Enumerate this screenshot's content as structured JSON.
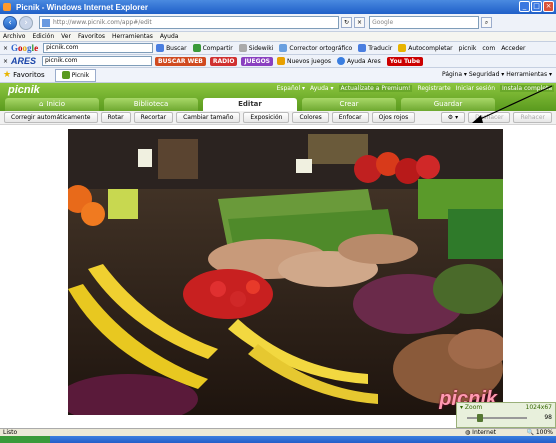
{
  "window": {
    "title": "Picnik - Windows Internet Explorer",
    "address": "http://www.picnik.com/app#/edit",
    "search_placeholder": "Google"
  },
  "menu": [
    "Archivo",
    "Edición",
    "Ver",
    "Favoritos",
    "Herramientas",
    "Ayuda"
  ],
  "google_toolbar": {
    "logo": "Google",
    "query": "picnik.com",
    "items": [
      "Buscar",
      "Compartir",
      "Sidewiki",
      "Corrector ortográfico",
      "Traducir",
      "Autocompletar",
      "picnik",
      "com",
      "Acceder"
    ]
  },
  "ares_toolbar": {
    "logo": "ARES",
    "query": "picnik.com",
    "items": [
      "BUSCAR WEB",
      "RADIO",
      "JUEGOS",
      "Nuevos juegos",
      "Ayuda Ares",
      "You Tube"
    ]
  },
  "favorites": {
    "label": "Favoritos",
    "tab": "Picnik",
    "right": "Página ▾  Seguridad ▾  Herramientas ▾"
  },
  "app": {
    "logo": "picnik",
    "top_links": [
      "Español ▾",
      "Ayuda ▾",
      "Actualízate a Premium!",
      "Registrarte",
      "Iniciar sesión",
      "Instala completa"
    ],
    "tabs": [
      {
        "label": "Inicio",
        "icon": "⌂"
      },
      {
        "label": "Biblioteca",
        "icon": ""
      },
      {
        "label": "Editar",
        "icon": ""
      },
      {
        "label": "Crear",
        "icon": ""
      },
      {
        "label": "Guardar",
        "icon": ""
      }
    ],
    "tools": [
      "Corregir automáticamente",
      "Rotar",
      "Recortar",
      "Cambiar tamaño",
      "Exposición",
      "Colores",
      "Enfocar",
      "Ojos rojos"
    ],
    "undo": "Deshacer",
    "redo": "Rehacer",
    "watermark": "picnik",
    "zoom": {
      "label": "Zoom",
      "size": "1024x67",
      "percent": "98"
    }
  },
  "status": {
    "left": "Listo",
    "zone": "Internet",
    "zoom": "100%"
  }
}
